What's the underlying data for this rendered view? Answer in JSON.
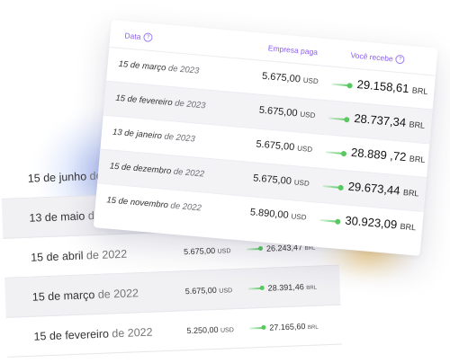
{
  "header": {
    "date_label": "Data",
    "paid_label": "Empresa paga",
    "receive_label": "Você recebe",
    "help_glyph": "?"
  },
  "front_rows": [
    {
      "date_prefix": "15 de março",
      "date_year": "de 2023",
      "paid": "5.675,00",
      "paid_cur": "USD",
      "recv": "29.158,61",
      "recv_cur": "BRL"
    },
    {
      "date_prefix": "15 de fevereiro",
      "date_year": "de 2023",
      "paid": "5.675,00",
      "paid_cur": "USD",
      "recv": "28.737,34",
      "recv_cur": "BRL"
    },
    {
      "date_prefix": "13 de janeiro",
      "date_year": "de 2023",
      "paid": "5.675,00",
      "paid_cur": "USD",
      "recv": "28.889 ,72",
      "recv_cur": "BRL"
    },
    {
      "date_prefix": "15 de dezembro",
      "date_year": "de 2022",
      "paid": "5.675,00",
      "paid_cur": "USD",
      "recv": "29.673,44",
      "recv_cur": "BRL"
    },
    {
      "date_prefix": "15 de novembro",
      "date_year": "de 2022",
      "paid": "5.890,00",
      "paid_cur": "USD",
      "recv": "30.923,09",
      "recv_cur": "BRL"
    }
  ],
  "back_rows": [
    {
      "date_prefix": "15 de junho",
      "date_year": "de",
      "paid": "",
      "paid_cur": "",
      "recv": "",
      "recv_cur": ""
    },
    {
      "date_prefix": "13 de maio",
      "date_year": "de 2022",
      "paid": "",
      "paid_cur": "",
      "recv": "",
      "recv_cur": ""
    },
    {
      "date_prefix": "15 de abril",
      "date_year": "de 2022",
      "paid": "5.675,00",
      "paid_cur": "USD",
      "recv": "26.243,47",
      "recv_cur": "BRL"
    },
    {
      "date_prefix": "15 de março",
      "date_year": "de 2022",
      "paid": "5.675,00",
      "paid_cur": "USD",
      "recv": "28.391,46",
      "recv_cur": "BRL"
    },
    {
      "date_prefix": "15 de fevereiro",
      "date_year": "de 2022",
      "paid": "5.250,00",
      "paid_cur": "USD",
      "recv": "27.165,60",
      "recv_cur": "BRL"
    }
  ],
  "colors": {
    "accent_purple": "#8a5cf0",
    "arrow_green": "#58c860",
    "glow_blue": "#6e8ceb",
    "glow_yellow": "#f8c45a"
  },
  "icons": {
    "help": "help-icon",
    "transfer_arrow": "transfer-arrow-icon"
  }
}
